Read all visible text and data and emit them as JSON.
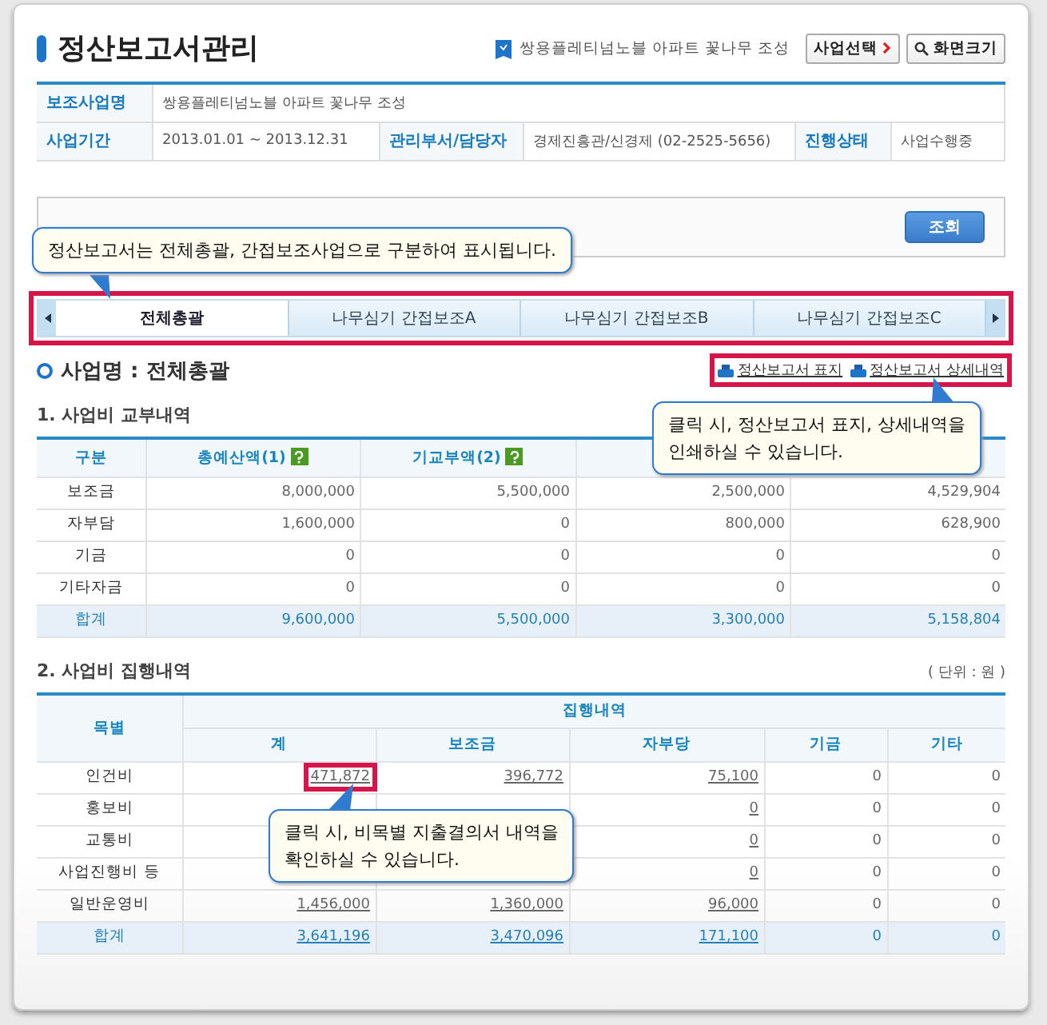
{
  "header": {
    "title": "정산보고서관리",
    "project": "쌍용플레티넘노블 아파트 꽃나무 조성",
    "buttons": [
      "사업선택",
      "화면크기"
    ]
  },
  "info": [
    [
      {
        "label": "보조사업명",
        "value": "쌍용플레티넘노블 아파트 꽃나무 조성"
      }
    ],
    [
      {
        "label": "사업기간",
        "value": "2013.01.01 ~ 2013.12.31"
      },
      {
        "label": "관리부서/담당자",
        "value": "경제진흥관/신경제 (02-2525-5656)"
      },
      {
        "label": "진행상태",
        "value": "사업수행중"
      }
    ]
  ],
  "search": {
    "button": "조회"
  },
  "tabs": [
    {
      "label": "전체총괄",
      "selected": true
    },
    {
      "label": "나무심기 간접보조A",
      "selected": false
    },
    {
      "label": "나무심기 간접보조B",
      "selected": false
    },
    {
      "label": "나무심기 간접보조C",
      "selected": false
    }
  ],
  "project_heading": "사업명 : 전체총괄",
  "print_links": [
    "정산보고서 표지",
    "정산보고서 상세내역"
  ],
  "grant_table": {
    "title": "1. 사업비 교부내역",
    "columns": [
      {
        "label": "구분",
        "help": false
      },
      {
        "label": "총예산액(1)",
        "help": true
      },
      {
        "label": "기교부액(2)",
        "help": true
      }
    ],
    "rows": [
      {
        "kind": "normal",
        "cells": [
          "보조금",
          "8,000,000",
          "5,500,000",
          "2,500,000",
          "4,529,904"
        ]
      },
      {
        "kind": "normal",
        "cells": [
          "자부담",
          "1,600,000",
          "0",
          "800,000",
          "628,900"
        ]
      },
      {
        "kind": "normal",
        "cells": [
          "기금",
          "0",
          "0",
          "0",
          "0"
        ]
      },
      {
        "kind": "normal",
        "cells": [
          "기타자금",
          "0",
          "0",
          "0",
          "0"
        ]
      },
      {
        "kind": "total",
        "cells": [
          "합계",
          "9,600,000",
          "5,500,000",
          "3,300,000",
          "5,158,804"
        ]
      }
    ]
  },
  "exec_table": {
    "title": "2. 사업비 집행내역",
    "unit": "( 단위 : 원 )",
    "row_header": "목별",
    "group_header": "집행내역",
    "columns": [
      {
        "label": "계",
        "link": true
      },
      {
        "label": "보조금",
        "link": true
      },
      {
        "label": "자부당",
        "link": true
      },
      {
        "label": "기금",
        "link": false
      },
      {
        "label": "기타",
        "link": false
      }
    ],
    "rows": [
      {
        "kind": "normal",
        "label": "인건비",
        "cells": [
          "471,872",
          "396,772",
          "75,100",
          "0",
          "0"
        ]
      },
      {
        "kind": "normal",
        "label": "홍보비",
        "cells": [
          null,
          null,
          "0",
          "0",
          "0"
        ]
      },
      {
        "kind": "normal",
        "label": "교통비",
        "cells": [
          null,
          null,
          "0",
          "0",
          "0"
        ]
      },
      {
        "kind": "normal",
        "label": "사업진행비 등",
        "cells": [
          null,
          null,
          "0",
          "0",
          "0"
        ]
      },
      {
        "kind": "normal",
        "label": "일반운영비",
        "cells": [
          "1,456,000",
          "1,360,000",
          "96,000",
          "0",
          "0"
        ]
      },
      {
        "kind": "total",
        "label": "합계",
        "cells": [
          "3,641,196",
          "3,470,096",
          "171,100",
          "0",
          "0"
        ]
      }
    ]
  },
  "callouts": [
    "정산보고서는 전체총괄, 간접보조사업으로 구분하여 표시됩니다.",
    "클릭 시, 정산보고서 표지, 상세내역을\n인쇄하실 수 있습니다.",
    "클릭 시, 비목별 지출결의서 내역을\n확인하실 수 있습니다."
  ]
}
